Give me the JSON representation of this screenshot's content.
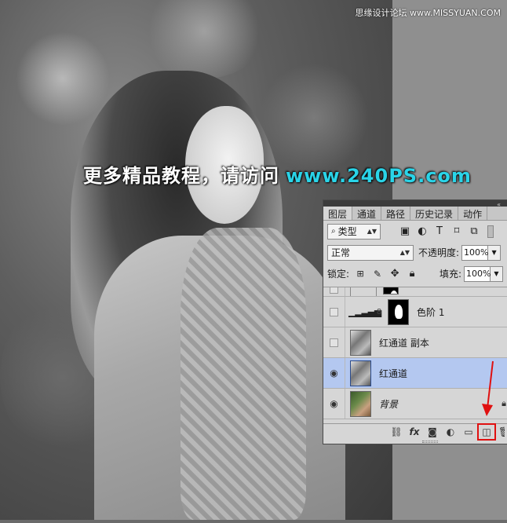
{
  "watermark": {
    "site": "思缘设计论坛 www.MISSYUAN.COM"
  },
  "promo": {
    "text": "更多精品教程，请访问",
    "url": "www.240PS.com"
  },
  "panel": {
    "tabs": [
      "图层",
      "通道",
      "路径",
      "历史记录",
      "动作"
    ],
    "filter": {
      "label": "类型",
      "icons": [
        "image-icon",
        "adjustment-icon",
        "type-icon",
        "shape-icon",
        "smart-object-icon"
      ]
    },
    "blend_mode": "正常",
    "opacity_label": "不透明度:",
    "opacity_value": "100%",
    "lock_label": "锁定:",
    "fill_label": "填充:",
    "fill_value": "100%",
    "layers": [
      {
        "name": "",
        "visible": false,
        "type": "partial"
      },
      {
        "name": "色阶 1",
        "visible": false,
        "type": "adjustment"
      },
      {
        "name": "红通道 副本",
        "visible": false,
        "type": "pixel"
      },
      {
        "name": "红通道",
        "visible": true,
        "type": "pixel",
        "selected": true
      },
      {
        "name": "背景",
        "visible": true,
        "type": "background",
        "locked": true
      }
    ],
    "bottom_icons": [
      "link-icon",
      "fx-icon",
      "mask-icon",
      "adjustment-icon",
      "folder-icon",
      "new-layer-icon",
      "trash-icon"
    ],
    "highlighted_icon": "new-layer-icon"
  },
  "colors": {
    "highlight_box": "#e01010",
    "selected_layer": "#b4c8f0",
    "promo_url": "#2ad4e8"
  }
}
